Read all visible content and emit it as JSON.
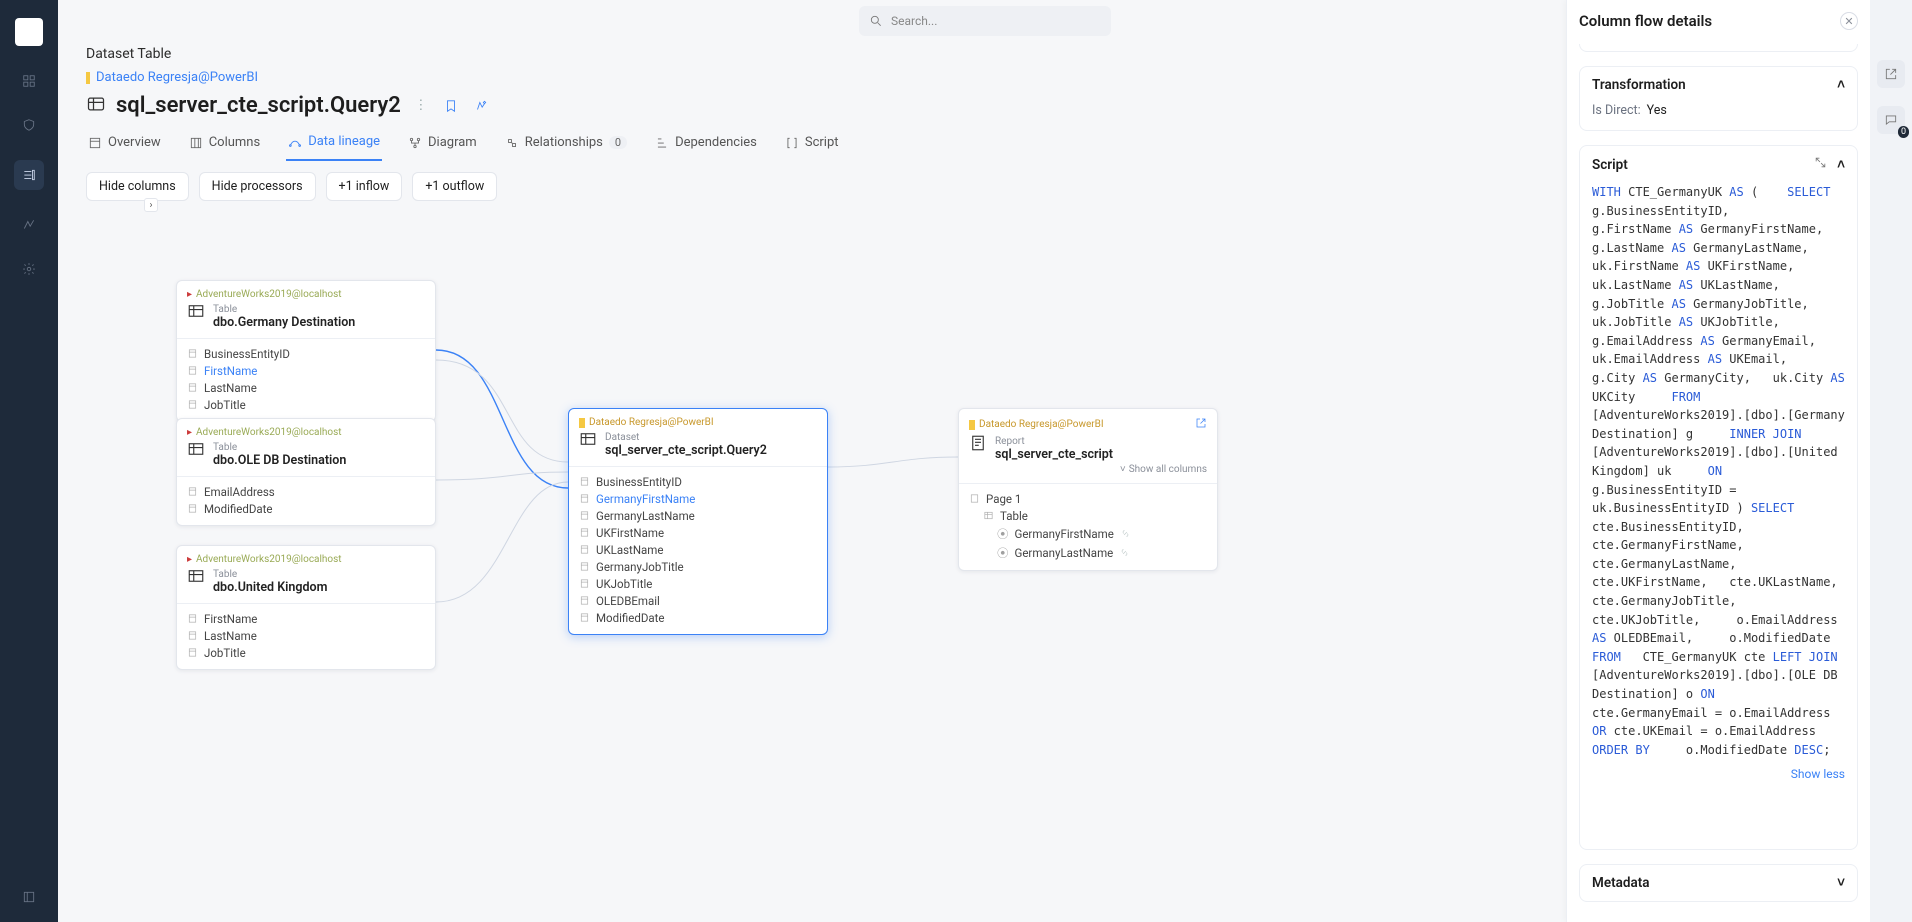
{
  "search": {
    "placeholder": "Search..."
  },
  "breadcrumb": {
    "category": "Dataset Table",
    "source_link": "Dataedo Regresja@PowerBI"
  },
  "title": "sql_server_cte_script.Query2",
  "tabs": [
    {
      "label": "Overview"
    },
    {
      "label": "Columns"
    },
    {
      "label": "Data lineage"
    },
    {
      "label": "Diagram"
    },
    {
      "label": "Relationships",
      "badge": "0"
    },
    {
      "label": "Dependencies"
    },
    {
      "label": "Script"
    }
  ],
  "toolbar": [
    "Hide columns",
    "Hide processors",
    "+1 inflow",
    "+1 outflow"
  ],
  "nodes": {
    "germany_dest": {
      "src": "AdventureWorks2019@localhost",
      "kind": "Table",
      "name": "dbo.Germany Destination",
      "cols": [
        "BusinessEntityID",
        "FirstName",
        "LastName",
        "JobTitle"
      ],
      "hl_index": 1
    },
    "ole_db": {
      "src": "AdventureWorks2019@localhost",
      "kind": "Table",
      "name": "dbo.OLE DB Destination",
      "cols": [
        "EmailAddress",
        "ModifiedDate"
      ]
    },
    "uk": {
      "src": "AdventureWorks2019@localhost",
      "kind": "Table",
      "name": "dbo.United Kingdom",
      "cols": [
        "FirstName",
        "LastName",
        "JobTitle"
      ]
    },
    "query2": {
      "src": "Dataedo Regresja@PowerBI",
      "kind": "Dataset",
      "name": "sql_server_cte_script.Query2",
      "cols": [
        "BusinessEntityID",
        "GermanyFirstName",
        "GermanyLastName",
        "UKFirstName",
        "UKLastName",
        "GermanyJobTitle",
        "UKJobTitle",
        "OLEDBEmail",
        "ModifiedDate"
      ],
      "hl_index": 1
    },
    "report": {
      "src": "Dataedo Regresja@PowerBI",
      "kind": "Report",
      "name": "sql_server_cte_script",
      "show_all": "Show all columns",
      "page": "Page 1",
      "table": "Table",
      "cols": [
        "GermanyFirstName",
        "GermanyLastName"
      ]
    }
  },
  "panel": {
    "title": "Column flow details",
    "transformation": {
      "heading": "Transformation",
      "is_direct_label": "Is Direct:",
      "is_direct_value": "Yes"
    },
    "script": {
      "heading": "Script",
      "show_less": "Show less",
      "tokens": [
        [
          "WITH",
          "kw"
        ],
        [
          " CTE_GermanyUK ",
          ""
        ],
        [
          "AS",
          "kw"
        ],
        [
          " (    ",
          ""
        ],
        [
          "SELECT",
          "kw"
        ],
        [
          "     g.BusinessEntityID,       g.FirstName ",
          ""
        ],
        [
          "AS",
          "kw"
        ],
        [
          " GermanyFirstName,       g.LastName ",
          ""
        ],
        [
          "AS",
          "kw"
        ],
        [
          " GermanyLastName,       uk.FirstName ",
          ""
        ],
        [
          "AS",
          "kw"
        ],
        [
          " UKFirstName,       uk.LastName ",
          ""
        ],
        [
          "AS",
          "kw"
        ],
        [
          " UKLastName,       g.JobTitle ",
          ""
        ],
        [
          "AS",
          "kw"
        ],
        [
          " GermanyJobTitle,       uk.JobTitle ",
          ""
        ],
        [
          "AS",
          "kw"
        ],
        [
          " UKJobTitle,       g.EmailAddress ",
          ""
        ],
        [
          "AS",
          "kw"
        ],
        [
          " GermanyEmail,       uk.EmailAddress ",
          ""
        ],
        [
          "AS",
          "kw"
        ],
        [
          " UKEmail,       g.City ",
          ""
        ],
        [
          "AS",
          "kw"
        ],
        [
          " GermanyCity,   uk.City ",
          ""
        ],
        [
          "AS",
          "kw"
        ],
        [
          " UKCity     ",
          ""
        ],
        [
          "FROM",
          "kw"
        ],
        [
          "     [AdventureWorks2019].[dbo].[Germany Destination] g     ",
          ""
        ],
        [
          "INNER JOIN",
          "kw"
        ],
        [
          "     [AdventureWorks2019].[dbo].[United Kingdom] uk     ",
          ""
        ],
        [
          "ON",
          "kw"
        ],
        [
          "         g.BusinessEntityID = uk.BusinessEntityID ) ",
          ""
        ],
        [
          "SELECT",
          "kw"
        ],
        [
          "   cte.BusinessEntityID,   cte.GermanyFirstName,   cte.GermanyLastName,     cte.UKFirstName,   cte.UKLastName,     cte.GermanyJobTitle,   cte.UKJobTitle,     o.EmailAddress ",
          ""
        ],
        [
          "AS",
          "kw"
        ],
        [
          " OLEDBEmail,     o.ModifiedDate ",
          ""
        ],
        [
          "FROM",
          "kw"
        ],
        [
          "   CTE_GermanyUK cte ",
          ""
        ],
        [
          "LEFT JOIN",
          "kw"
        ],
        [
          "   [AdventureWorks2019].[dbo].[OLE DB Destination] o ",
          ""
        ],
        [
          "ON",
          "kw"
        ],
        [
          "     cte.GermanyEmail = o.EmailAddress ",
          ""
        ],
        [
          "OR",
          "kw"
        ],
        [
          " cte.UKEmail = o.EmailAddress ",
          ""
        ],
        [
          "ORDER BY",
          "kw"
        ],
        [
          "     o.ModifiedDate ",
          ""
        ],
        [
          "DESC",
          "kw"
        ],
        [
          ";",
          ""
        ]
      ]
    },
    "metadata": {
      "heading": "Metadata"
    }
  },
  "right_rail_count": "0"
}
